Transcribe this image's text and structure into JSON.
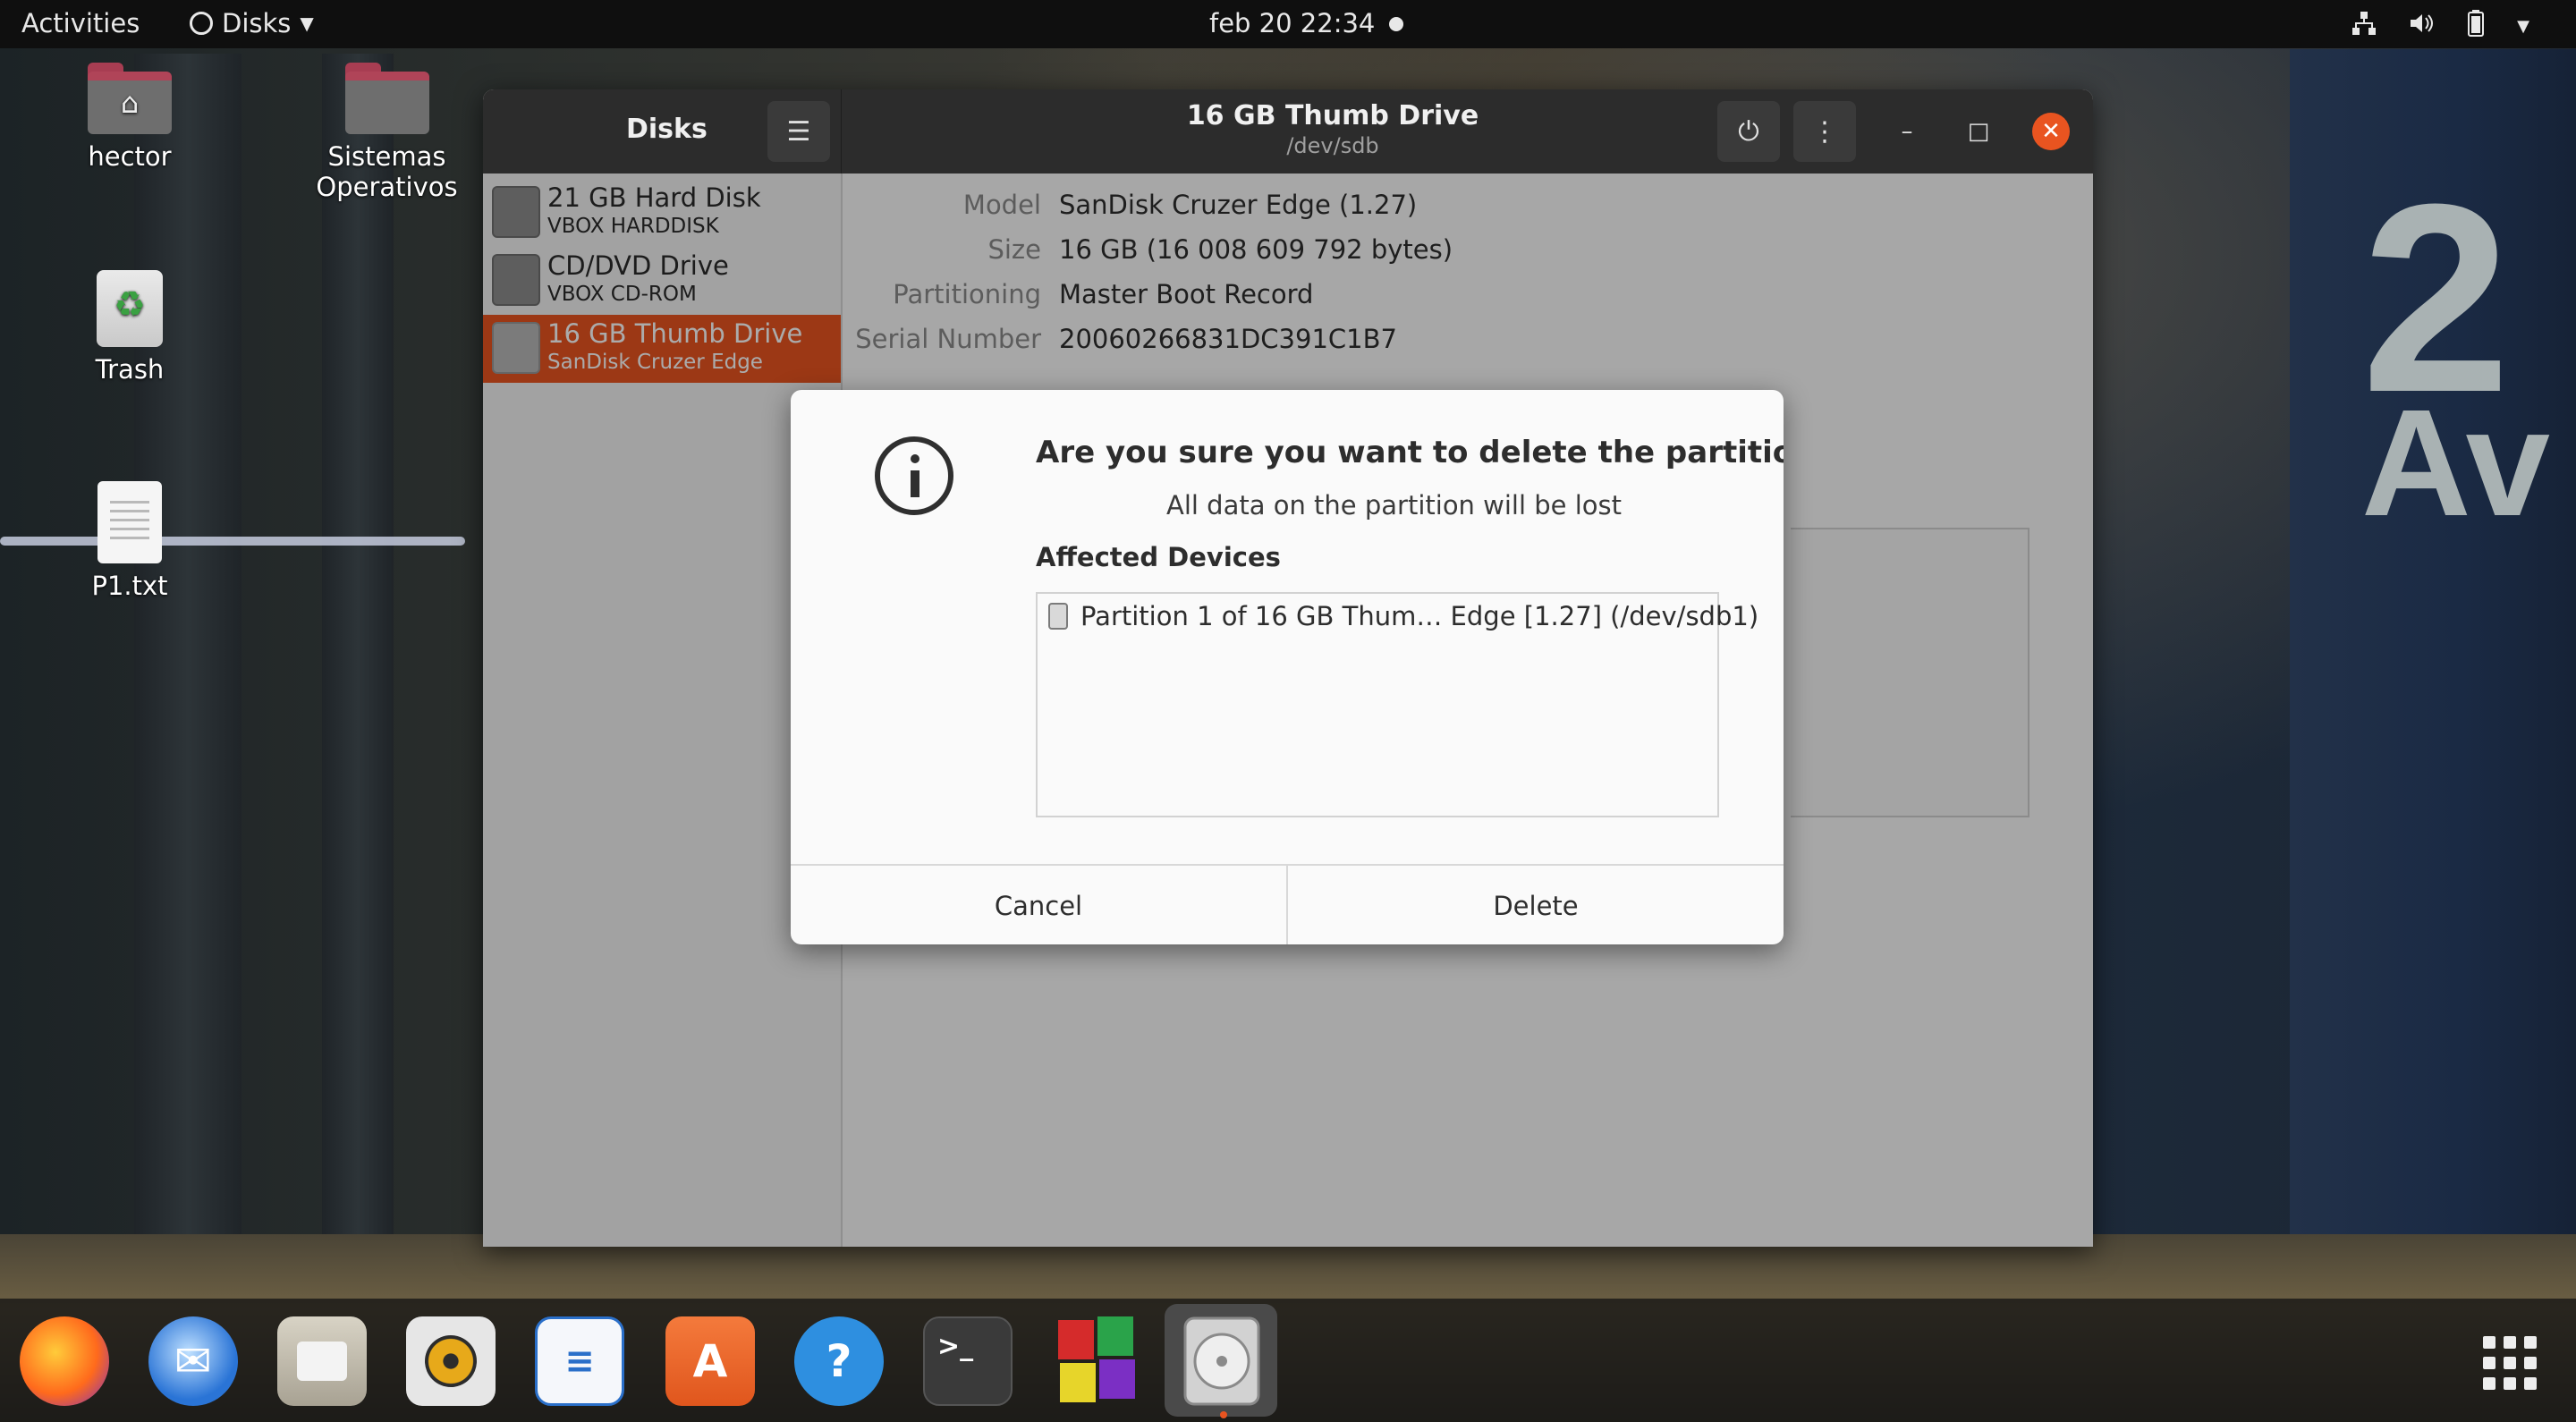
{
  "topbar": {
    "activities": "Activities",
    "app_menu": "Disks",
    "clock": "feb 20  22:34"
  },
  "desktop": {
    "icons": [
      {
        "label": "hector"
      },
      {
        "label": "Sistemas Operativos"
      },
      {
        "label": "Trash"
      },
      {
        "label": "P1.txt"
      }
    ]
  },
  "window": {
    "sidebar_title": "Disks",
    "title": "16 GB Thumb Drive",
    "subtitle": "/dev/sdb",
    "drives": [
      {
        "name": "21 GB Hard Disk",
        "sub": "VBOX HARDDISK"
      },
      {
        "name": "CD/DVD Drive",
        "sub": "VBOX CD-ROM"
      },
      {
        "name": "16 GB Thumb Drive",
        "sub": "SanDisk Cruzer Edge",
        "selected": true
      }
    ],
    "details": [
      {
        "key": "Model",
        "value": "SanDisk Cruzer Edge (1.27)"
      },
      {
        "key": "Size",
        "value": "16 GB (16 008 609 792 bytes)"
      },
      {
        "key": "Partitioning",
        "value": "Master Boot Record"
      },
      {
        "key": "Serial Number",
        "value": "20060266831DC391C1B7"
      }
    ]
  },
  "dialog": {
    "heading": "Are you sure you want to delete the partition?",
    "subtext": "All data on the partition will be lost",
    "affected_label": "Affected Devices",
    "affected_items": [
      "Partition 1 of 16 GB Thum… Edge [1.27] (/dev/sdb1)"
    ],
    "cancel_label": "Cancel",
    "delete_label": "Delete"
  },
  "dock": {
    "apps": [
      "firefox-icon",
      "thunderbird-icon",
      "files-icon",
      "rhythmbox-icon",
      "libreoffice-writer-icon",
      "software-icon",
      "help-icon",
      "terminal-icon",
      "app-grid-colored-icon",
      "disks-icon"
    ]
  },
  "colors": {
    "accent": "#e95420",
    "headerbar": "#2c2c2c"
  }
}
